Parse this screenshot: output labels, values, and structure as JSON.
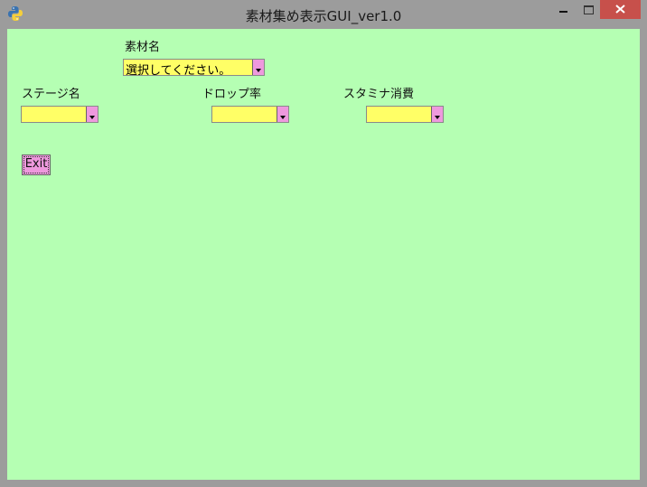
{
  "window": {
    "title": "素材集め表示GUI_ver1.0",
    "colors": {
      "frame": "#9c9c9c",
      "client": "#b5ffb3",
      "combo_bg": "#ffff66",
      "accent": "#ee99dd",
      "close": "#c7504b"
    }
  },
  "icons": {
    "app": "python-icon",
    "minimize": "minimize-icon",
    "maximize": "maximize-icon",
    "close": "close-icon",
    "dropdown": "chevron-down-icon"
  },
  "material": {
    "label": "素材名",
    "selected": "選択してください。"
  },
  "stage": {
    "label": "ステージ名",
    "selected": ""
  },
  "drop_rate": {
    "label": "ドロップ率",
    "selected": ""
  },
  "stamina": {
    "label": "スタミナ消費",
    "selected": ""
  },
  "exit_button": {
    "label": "Exit"
  }
}
